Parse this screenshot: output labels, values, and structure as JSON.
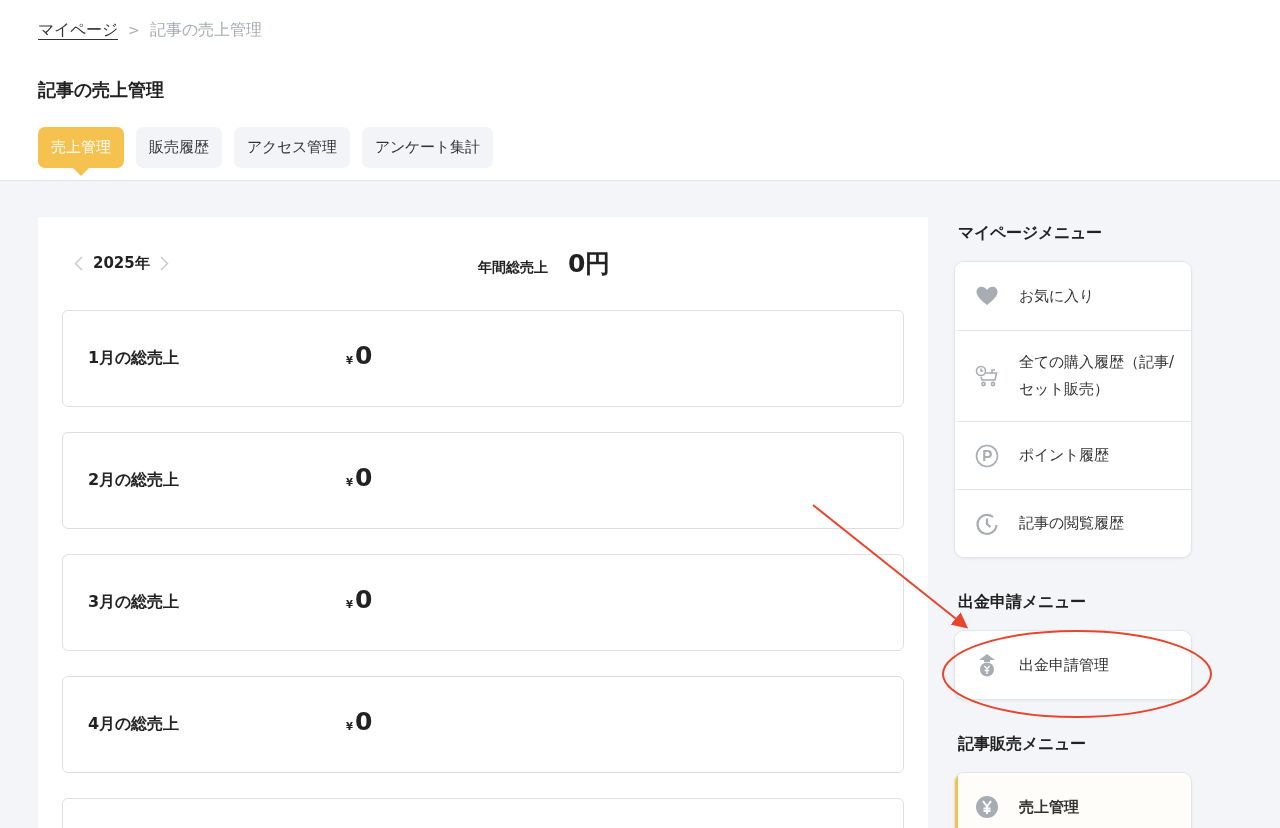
{
  "breadcrumb": [
    {
      "label": "マイページ",
      "kind": "link"
    },
    {
      "label": ">",
      "kind": "separator"
    },
    {
      "label": "記事の売上管理",
      "kind": "current"
    }
  ],
  "page_title": "記事の売上管理",
  "tabs": [
    {
      "label": "売上管理",
      "selected": true
    },
    {
      "label": "販売履歴",
      "selected": false
    },
    {
      "label": "アクセス管理",
      "selected": false
    },
    {
      "label": "アンケート集計",
      "selected": false
    }
  ],
  "sales": {
    "year": "2025年",
    "annual_label": "年間総売上",
    "annual_value": "0円",
    "months": [
      {
        "label": "1月の総売上",
        "currency": "¥",
        "value": "0"
      },
      {
        "label": "2月の総売上",
        "currency": "¥",
        "value": "0"
      },
      {
        "label": "3月の総売上",
        "currency": "¥",
        "value": "0"
      },
      {
        "label": "4月の総売上",
        "currency": "¥",
        "value": "0"
      }
    ]
  },
  "sidebar": [
    {
      "title": "マイページメニュー",
      "items": [
        {
          "label": "お気に入り",
          "kind": "heart",
          "selected": false
        },
        {
          "label": "全ての購入履歴（記事/セット販売）",
          "kind": "cart",
          "selected": false
        },
        {
          "label": "ポイント履歴",
          "kind": "points",
          "selected": false
        },
        {
          "label": "記事の閲覧履歴",
          "kind": "clock",
          "selected": false
        }
      ]
    },
    {
      "title": "出金申請メニュー",
      "items": [
        {
          "label": "出金申請管理",
          "kind": "withdraw",
          "selected": false
        }
      ]
    },
    {
      "title": "記事販売メニュー",
      "items": [
        {
          "label": "売上管理",
          "kind": "yen",
          "selected": true
        }
      ]
    }
  ]
}
